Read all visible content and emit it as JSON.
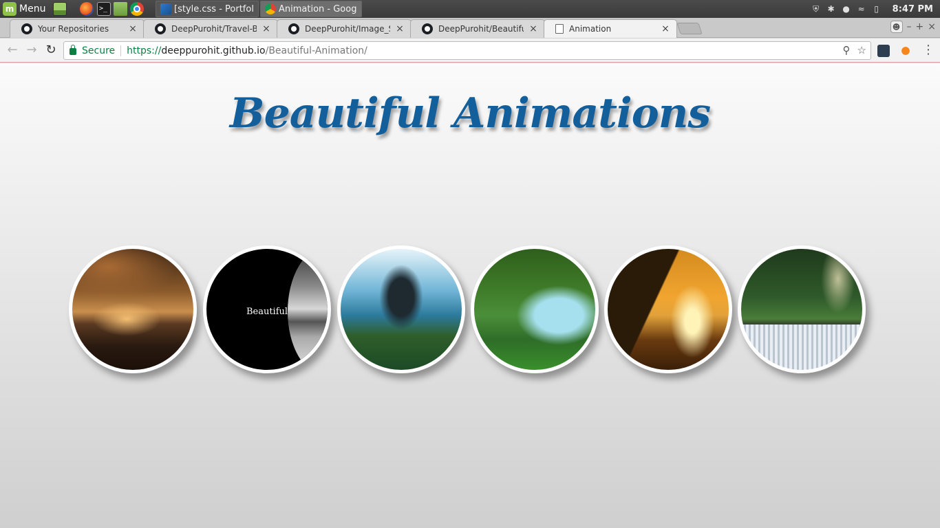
{
  "taskbar": {
    "menu_label": "Menu",
    "logo_text": "m",
    "windows": [
      {
        "label": "[style.css - Portfoli...",
        "icon": "vscode-icon"
      },
      {
        "label": "Animation - Googl...",
        "icon": "chrome-icon"
      }
    ],
    "clock": "8:47 PM",
    "terminal_glyph": ">_"
  },
  "browser": {
    "tabs": [
      {
        "title": "Your Repositories",
        "icon": "github-icon"
      },
      {
        "title": "DeepPurohit/Travel-Boo",
        "icon": "github-icon"
      },
      {
        "title": "DeepPurohit/Image_Slid",
        "icon": "github-icon"
      },
      {
        "title": "DeepPurohit/Beautiful-A",
        "icon": "github-icon"
      },
      {
        "title": "Animation",
        "icon": "page-icon"
      }
    ],
    "close_glyph": "×",
    "window_controls": [
      "–",
      "+",
      "×"
    ],
    "secure_label": "Secure",
    "url_scheme": "https://",
    "url_host": "deeppurohit.github.io",
    "url_path": "/Beautiful-Animation/"
  },
  "page": {
    "title": "Beautiful Animations",
    "circles": [
      {
        "image": "sunset-lake"
      },
      {
        "image": "black-moon",
        "label": "Beautiful"
      },
      {
        "image": "blue-tree"
      },
      {
        "image": "green-river"
      },
      {
        "image": "golden-bridge"
      },
      {
        "image": "forest-waterfall"
      }
    ]
  },
  "colors": {
    "title": "#135f9c",
    "secure": "#0b8043",
    "circle_border": "#ffffff"
  }
}
